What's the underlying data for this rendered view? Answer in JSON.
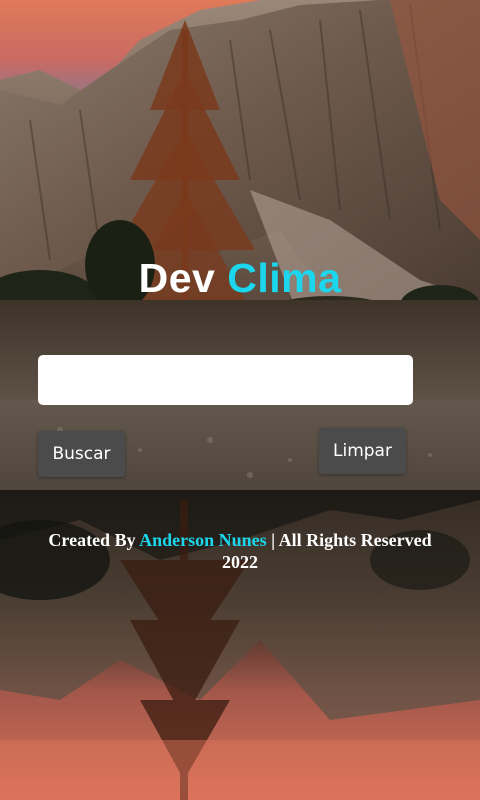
{
  "app": {
    "title_part_1": "Dev",
    "title_part_2": "Clima"
  },
  "search": {
    "value": "",
    "placeholder": ""
  },
  "buttons": {
    "search_label": "Buscar",
    "clear_label": "Limpar"
  },
  "footer": {
    "prefix": "Created By ",
    "author": "Anderson Nunes",
    "suffix": " | All Rights Reserved 2022"
  },
  "colors": {
    "accent": "#1bd6ec",
    "title": "#ffffff",
    "button_bg": "#4b4b4b",
    "input_bg": "#ffffff"
  }
}
